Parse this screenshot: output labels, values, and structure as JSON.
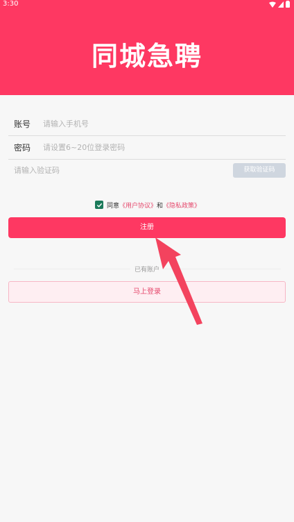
{
  "status": {
    "time": "3:30"
  },
  "header": {
    "title": "同城急聘"
  },
  "form": {
    "account_label": "账号",
    "account_placeholder": "请输入手机号",
    "password_label": "密码",
    "password_placeholder": "请设置6~20位登录密码",
    "code_placeholder": "请输入验证码",
    "code_button": "获取验证码"
  },
  "agreement": {
    "prefix": "同意",
    "user_agreement": "《用户协议》",
    "and": "和",
    "privacy_policy": "《隐私政策》",
    "checked": true
  },
  "buttons": {
    "register": "注册",
    "login": "马上登录"
  },
  "have_account": "已有账户",
  "colors": {
    "brand": "#fe3862",
    "checkbox": "#1b7a5a",
    "link": "#e5486c",
    "code_button": "#cfd6df"
  },
  "icons": [
    "wifi-icon",
    "signal-icon",
    "battery-icon",
    "check-icon",
    "arrow-annotation"
  ]
}
